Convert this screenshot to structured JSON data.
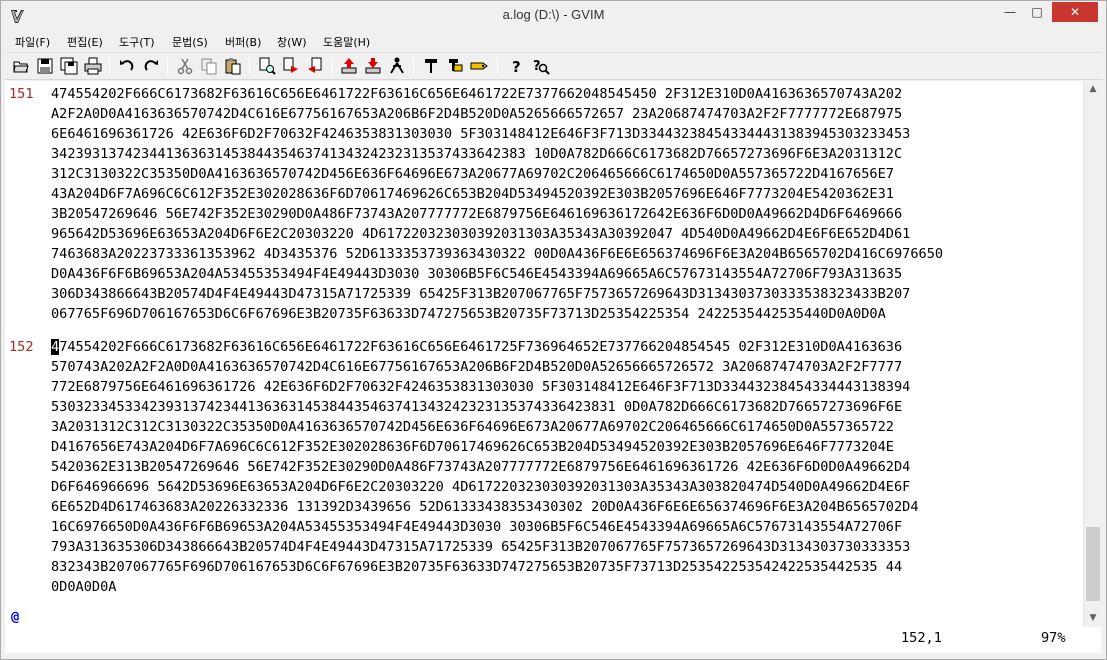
{
  "window": {
    "title": "a.log (D:\\) - GVIM",
    "min_glyph": "—",
    "max_glyph": "□",
    "close_glyph": "✕"
  },
  "menu": [
    "파일(F)",
    "편집(E)",
    "도구(T)",
    "문법(S)",
    "버퍼(B)",
    "창(W)",
    "도움말(H)"
  ],
  "toolbar_icons": [
    "open-icon",
    "save-icon",
    "save-all-icon",
    "print-icon",
    "undo-icon",
    "redo-icon",
    "cut-icon",
    "copy-icon",
    "paste-icon",
    "find-replace-icon",
    "find-next-icon",
    "find-prev-icon",
    "load-session-icon",
    "save-session-icon",
    "run-script-icon",
    "make-icon",
    "build-tags-icon",
    "jump-tag-icon",
    "help-icon",
    "find-help-icon"
  ],
  "editor": {
    "line151": {
      "number": "151",
      "rows": [
        "474554202F666C6173682F63616C656E6461722F63616C656E6461722E7377662048545450 2F312E310D0A4163636570743A202",
        "A2F2A0D0A4163636570742D4C616E67756167653A206B6F2D4B520D0A5265666572657 23A20687474703A2F2F7777772E687975",
        "6E6461696361726 42E636F6D2F70632F4246353831303030 5F303148412E646F3F713D334432384543344431383945303233453",
        "3423931374234413636314538443546374134324232313537433642383 10D0A782D666C6173682D76657273696F6E3A2031312C",
        "312C3130322C35350D0A4163636570742D456E636F64696E673A20677A69702C206465666C6174650D0A557365722D4167656E7",
        "43A204D6F7A696C6C612F352E302028636F6D70617469626C653B204D53494520392E303B2057696E646F7773204E5420362E31",
        "3B20547269646 56E742F352E30290D0A486F73743A207777772E6879756E646169636172642E636F6D0D0A49662D4D6F6469666",
        "965642D53696E63653A204D6F6E2C20303220 4D617220323030392031303A35343A30392047 4D540D0A49662D4E6F6E652D4D61",
        "7463683A20223733361353962 4D3435376 52D6133353739363430322 00D0A436F6E6E656374696F6E3A204B6565702D416C6976650",
        "D0A436F6F6B69653A204A53455353494F4E49443D3030 30306B5F6C546E4543394A69665A6C57673143554A72706F793A313635",
        "306D343866643B20574D4F4E49443D47315A71725339 65425F313B207067765F7573657269643D3134303730333538323433B207",
        "067765F696D706167653D6C6F67696E3B20735F63633D747275653B20735F73713D25354225354 2422535442535440D0A0D0A"
      ]
    },
    "line152": {
      "number": "152",
      "cursor_char": "4",
      "rows": [
        "74554202F666C6173682F63616C656E6461722F63616C656E6461725F736964652E737766204854545 02F312E310D0A4163636",
        "570743A202A2F2A0D0A4163636570742D4C616E67756167653A206B6F2D4B520D0A52656665726572 3A20687474703A2F2F7777",
        "772E6879756E6461696361726 42E636F6D2F70632F4246353831303030 5F303148412E646F3F713D33443238454334443138394",
        "530323345334239313742344136363145384435463741343242323135374336423831 0D0A782D666C6173682D76657273696F6E",
        "3A2031312C312C3130322C35350D0A4163636570742D456E636F64696E673A20677A69702C206465666C6174650D0A557365722",
        "D4167656E743A204D6F7A696C6C612F352E302028636F6D70617469626C653B204D53494520392E303B2057696E646F7773204E",
        "5420362E313B20547269646 56E742F352E30290D0A486F73743A207777772E6879756E6461696361726 42E636F6D0D0A49662D4",
        "D6F646966696 5642D53696E63653A204D6F6E2C20303220 4D617220323030392031303A35343A303820474D540D0A49662D4E6F",
        "6E652D4D617463683A20226332336 131392D3439656 52D61333438353430302 20D0A436F6E6E656374696F6E3A204B6565702D4",
        "16C6976650D0A436F6F6B69653A204A53455353494F4E49443D3030 30306B5F6C546E4543394A69665A6C57673143554A72706F",
        "793A313635306D343866643B20574D4F4E49443D47315A71725339 65425F313B207067765F7573657269643D3134303730333353",
        "832343B207067765F696D706167653D6C6F67696E3B20735F63633D747275653B20735F73713D253542253542422535442535 44",
        "0D0A0D0A"
      ]
    },
    "end_marker": "@"
  },
  "status": {
    "position": "152,1",
    "percent": "97%"
  }
}
